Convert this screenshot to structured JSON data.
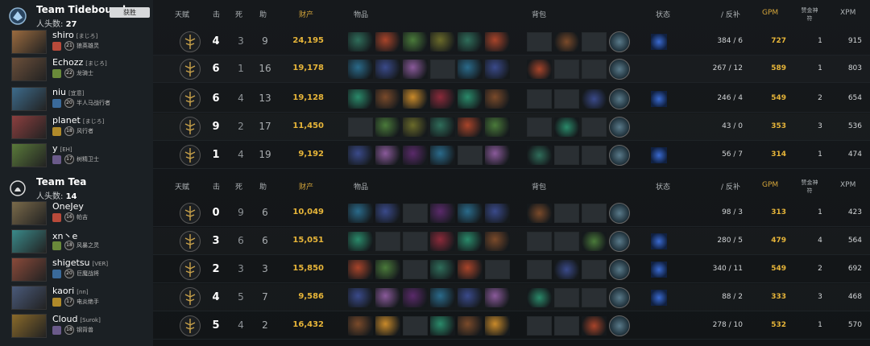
{
  "headers": {
    "talent": "天赋",
    "kills": "击",
    "deaths": "死",
    "assists": "助",
    "networth": "财产",
    "items": "物品",
    "backpack": "背包",
    "status": "状态",
    "lh_dn": "/ 反补",
    "gpm": "GPM",
    "aegis": "赞金神符",
    "xpm": "XPM"
  },
  "teams": [
    {
      "name": "Team Tidebound",
      "kills_label": "人头数:",
      "kills": "27",
      "winner_badge": "获胜",
      "players": [
        {
          "name": "shiro",
          "tag": "[まじろ]",
          "level": "21",
          "hero": "狼英雄灵",
          "kills": "4",
          "deaths": "3",
          "assists": "9",
          "networth": "24,195",
          "lh": "384 / 6",
          "gpm": "727",
          "runes": "1",
          "xpm": "915"
        },
        {
          "name": "Echozz",
          "tag": "[まじろ]",
          "level": "22",
          "hero": "龙骑士",
          "kills": "6",
          "deaths": "1",
          "assists": "16",
          "networth": "19,178",
          "lh": "267 / 12",
          "gpm": "589",
          "runes": "1",
          "xpm": "803"
        },
        {
          "name": "niu",
          "tag": "[宜意]",
          "level": "20",
          "hero": "半人马战行者",
          "kills": "6",
          "deaths": "4",
          "assists": "13",
          "networth": "19,128",
          "lh": "246 / 4",
          "gpm": "549",
          "runes": "2",
          "xpm": "654"
        },
        {
          "name": "planet",
          "tag": "[まじろ]",
          "level": "18",
          "hero": "风行者",
          "kills": "9",
          "deaths": "2",
          "assists": "17",
          "networth": "11,450",
          "lh": "43 / 0",
          "gpm": "353",
          "runes": "3",
          "xpm": "536"
        },
        {
          "name": "y",
          "tag": "[EH]",
          "level": "17",
          "hero": "树精卫士",
          "kills": "1",
          "deaths": "4",
          "assists": "19",
          "networth": "9,192",
          "lh": "56 / 7",
          "gpm": "314",
          "runes": "1",
          "xpm": "474"
        }
      ]
    },
    {
      "name": "Team Tea",
      "kills_label": "人头数:",
      "kills": "14",
      "players": [
        {
          "name": "OneJey",
          "tag": "",
          "level": "16",
          "hero": "帕吉",
          "kills": "0",
          "deaths": "9",
          "assists": "6",
          "networth": "10,049",
          "lh": "98 / 3",
          "gpm": "313",
          "runes": "1",
          "xpm": "423"
        },
        {
          "name": "xn丶e",
          "tag": "",
          "level": "18",
          "hero": "风暴之灵",
          "kills": "3",
          "deaths": "6",
          "assists": "6",
          "networth": "15,051",
          "lh": "280 / 5",
          "gpm": "479",
          "runes": "4",
          "xpm": "564"
        },
        {
          "name": "shigetsu",
          "tag": "[VER]",
          "level": "20",
          "hero": "巨魔战将",
          "kills": "2",
          "deaths": "3",
          "assists": "3",
          "networth": "15,850",
          "lh": "340 / 11",
          "gpm": "549",
          "runes": "2",
          "xpm": "692"
        },
        {
          "name": "kaori",
          "tag": "[nn]",
          "level": "17",
          "hero": "电炎绝手",
          "kills": "4",
          "deaths": "5",
          "assists": "7",
          "networth": "9,586",
          "lh": "88 / 2",
          "gpm": "333",
          "runes": "3",
          "xpm": "468"
        },
        {
          "name": "Cloud",
          "tag": "[Surok]",
          "level": "18",
          "hero": "钢背兽",
          "kills": "5",
          "deaths": "4",
          "assists": "2",
          "networth": "16,432",
          "lh": "278 / 10",
          "gpm": "532",
          "runes": "1",
          "xpm": "570"
        }
      ]
    }
  ],
  "colors": {
    "gold": "#e7b539",
    "accent": "#d4a53a",
    "win_badge": "#d7d9db"
  }
}
